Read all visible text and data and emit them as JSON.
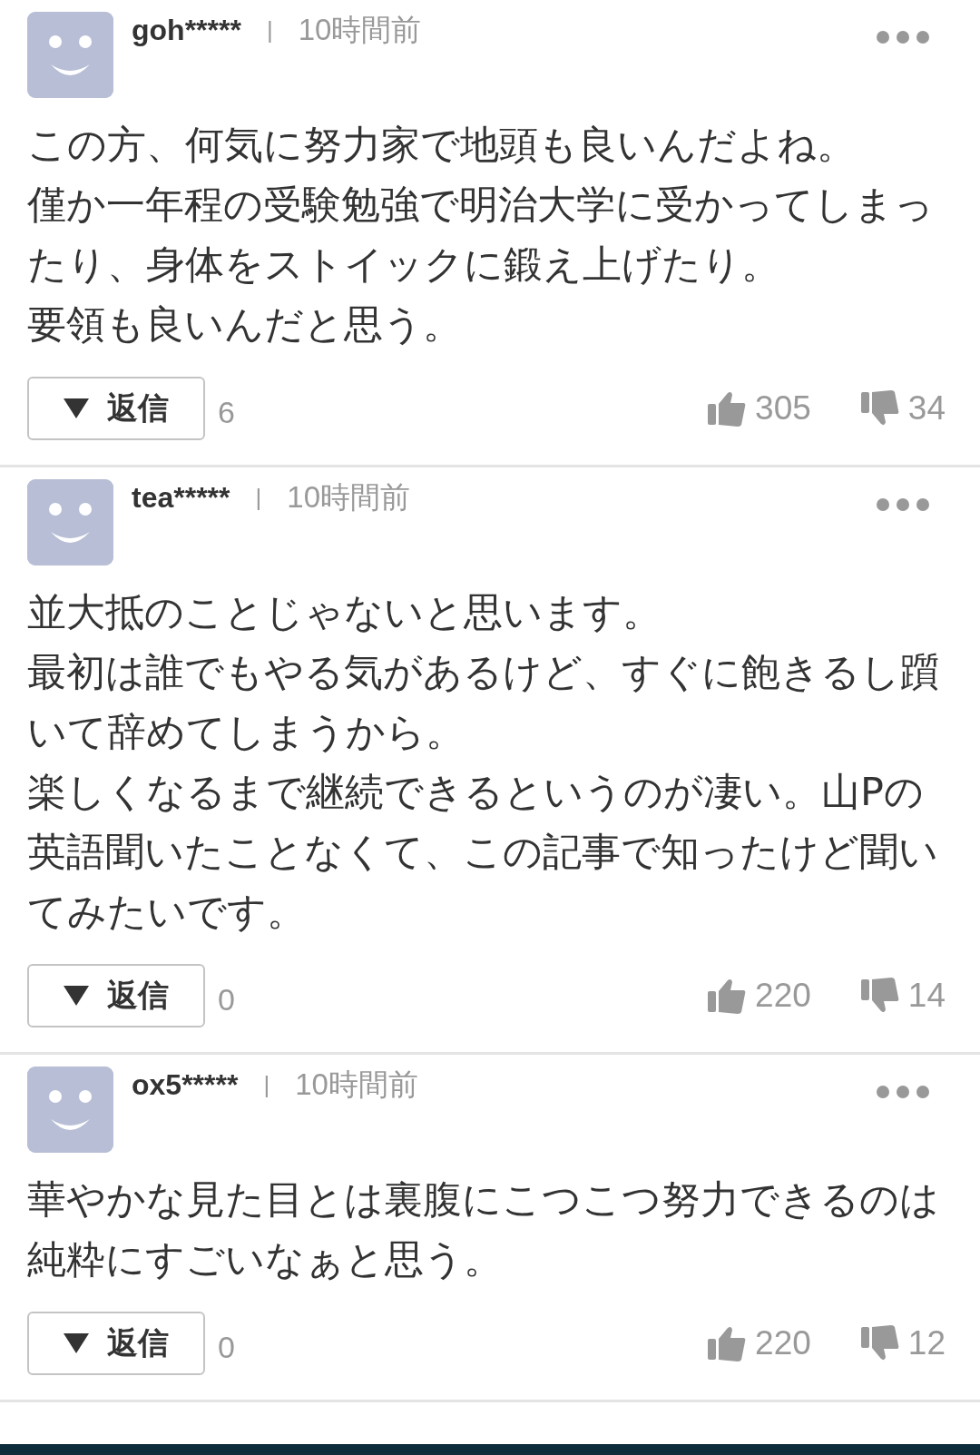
{
  "comments": [
    {
      "user": "goh*****",
      "separator": "|",
      "time": "10時間前",
      "paragraphs": [
        "この方、何気に努力家で地頭も良いんだよね。",
        "僅か一年程の受験勉強で明治大学に受かってしまったり、身体をストイックに鍛え上げたり。",
        "要領も良いんだと思う。"
      ],
      "reply_label": "返信",
      "reply_count": "6",
      "likes": "305",
      "dislikes": "34"
    },
    {
      "user": "tea*****",
      "separator": "|",
      "time": "10時間前",
      "paragraphs": [
        "並大抵のことじゃないと思います。",
        "最初は誰でもやる気があるけど、すぐに飽きるし躓いて辞めてしまうから。",
        "楽しくなるまで継続できるというのが凄い。山Pの英語聞いたことなくて、この記事で知ったけど聞いてみたいです。"
      ],
      "reply_label": "返信",
      "reply_count": "0",
      "likes": "220",
      "dislikes": "14"
    },
    {
      "user": "ox5*****",
      "separator": "|",
      "time": "10時間前",
      "paragraphs": [
        "華やかな見た目とは裏腹にこつこつ努力できるのは純粋にすごいなぁと思う。"
      ],
      "reply_label": "返信",
      "reply_count": "0",
      "likes": "220",
      "dislikes": "12"
    }
  ]
}
